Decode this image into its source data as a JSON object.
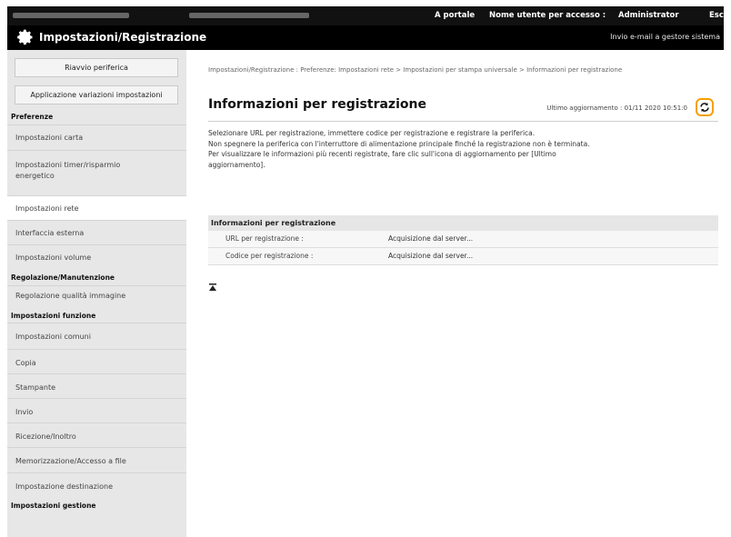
{
  "topbar": {
    "portal_link": "A portale",
    "user_label": "Nome utente per accesso :",
    "user_name": "Administrator",
    "logout": "Esci"
  },
  "header": {
    "title": "Impostazioni/Registrazione",
    "mail_link": "Invio e-mail a gestore sistema"
  },
  "sidebar": {
    "reboot_button": "Riavvio periferica",
    "apply_button": "Applicazione variazioni impostazioni",
    "sections": {
      "preferences": "Preferenze",
      "adjust": "Regolazione/Manutenzione",
      "function": "Impostazioni funzione",
      "management": "Impostazioni gestione"
    },
    "items": {
      "paper": "Impostazioni carta",
      "timer_l1": "Impostazioni timer/risparmio",
      "timer_l2": "energetico",
      "network": "Impostazioni rete",
      "external": "Interfaccia esterna",
      "volume": "Impostazioni volume",
      "quality": "Regolazione qualità immagine",
      "common": "Impostazioni comuni",
      "copy": "Copia",
      "printer": "Stampante",
      "send": "Invio",
      "receive": "Ricezione/Inoltro",
      "store": "Memorizzazione/Accesso a file",
      "destination": "Impostazione destinazione"
    }
  },
  "main": {
    "breadcrumb": "Impostazioni/Registrazione : Preferenze: Impostazioni rete > Impostazioni per stampa universale > Informazioni per registrazione",
    "page_title": "Informazioni per registrazione",
    "last_update": "Ultimo aggiornamento : 01/11 2020 10:51:0",
    "description": [
      "Selezionare URL per registrazione, immettere codice per registrazione e registrare la periferica.",
      "Non spegnere la periferica con l'interruttore di alimentazione principale finché la registrazione non è terminata.",
      "Per visualizzare le informazioni più recenti registrate, fare clic sull'icona di aggiornamento per [Ultimo aggiornamento]."
    ],
    "table": {
      "header": "Informazioni per registrazione",
      "rows": [
        {
          "label": "URL per registrazione :",
          "value": "Acquisizione dal server..."
        },
        {
          "label": "Codice per registrazione :",
          "value": "Acquisizione dal server..."
        }
      ]
    }
  },
  "colors": {
    "accent": "#f5a000",
    "topbar": "#111111",
    "sidebar": "#e7e7e7"
  }
}
